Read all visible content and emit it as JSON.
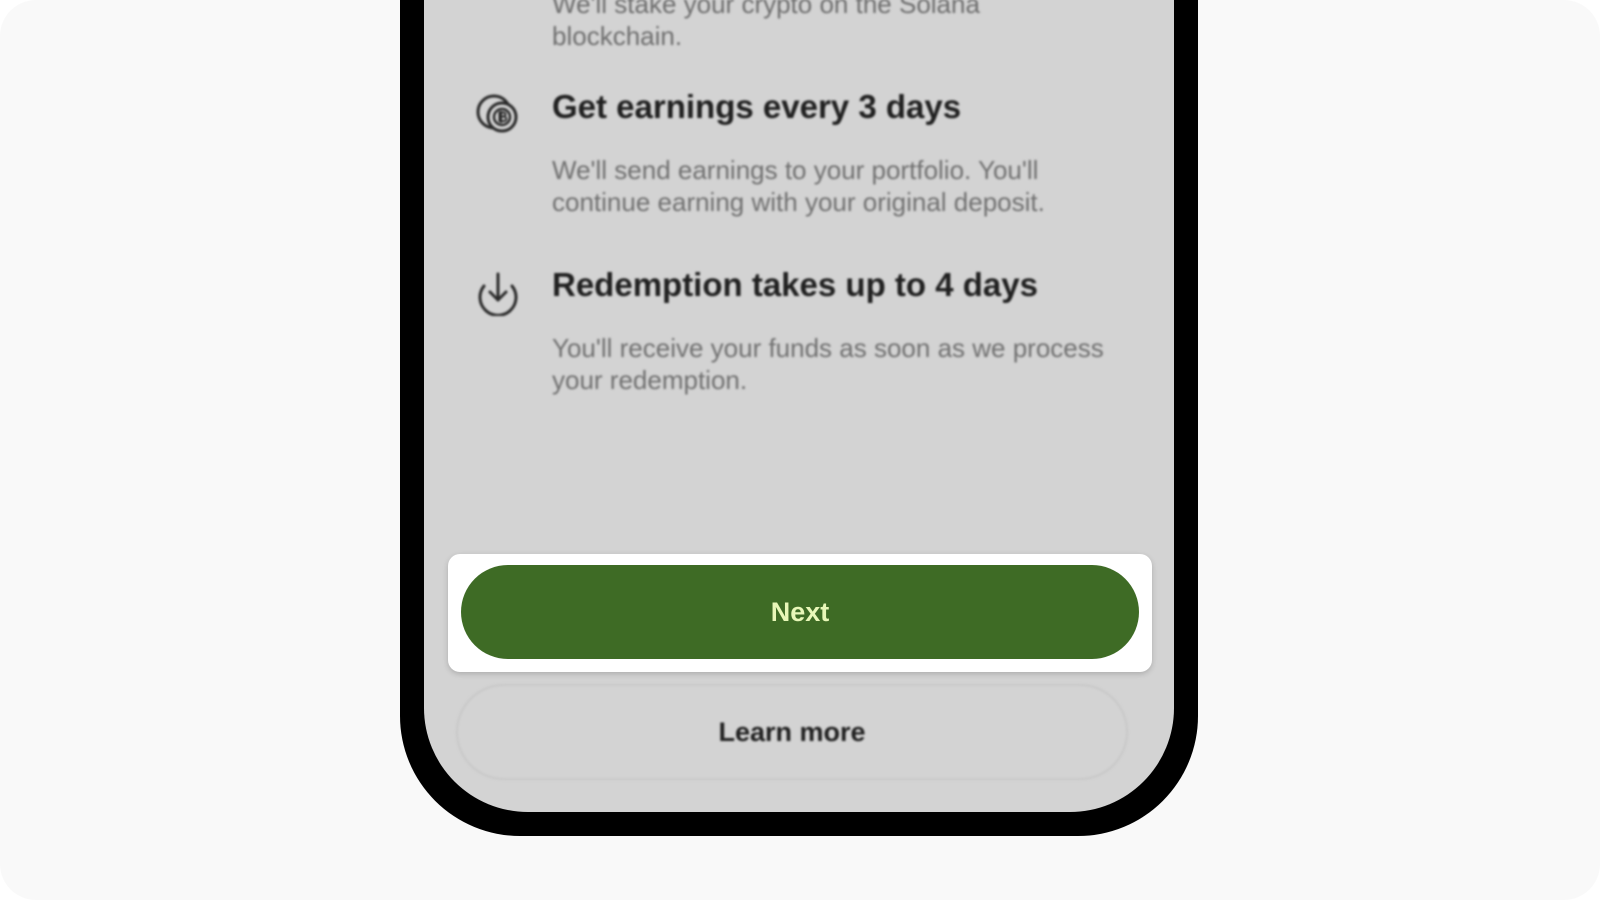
{
  "intro": {
    "partial_text": "We'll stake your crypto on the Solana blockchain."
  },
  "features": [
    {
      "icon": "coins-icon",
      "title": "Get earnings every 3 days",
      "description": "We'll send earnings to your portfolio. You'll continue earning with your original deposit."
    },
    {
      "icon": "download-icon",
      "title": "Redemption takes up to 4 days",
      "description": "You'll receive your funds as soon as we process your redemption."
    }
  ],
  "actions": {
    "next_label": "Next",
    "learn_more_label": "Learn more"
  },
  "colors": {
    "primary": "#3e6b25",
    "primary_text": "#e8f7b8",
    "screen_bg": "#d3d3d3"
  }
}
